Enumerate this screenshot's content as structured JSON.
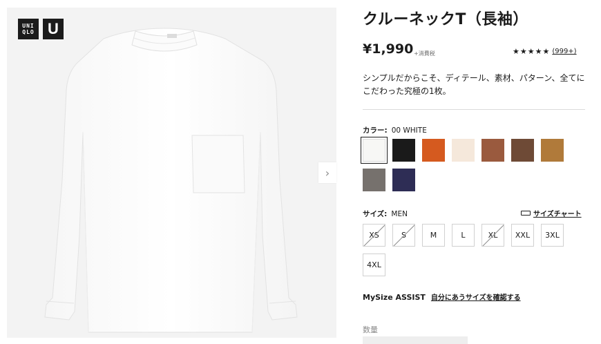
{
  "brand": {
    "logo_text_top": "UNI",
    "logo_text_bottom": "QLO",
    "logo_u": "U"
  },
  "product": {
    "title": "クルーネックT（長袖）",
    "price": "¥1,990",
    "tax_note": "+消費税",
    "rating_stars": "★★★★★",
    "review_count": "(999+)",
    "description": "シンプルだからこそ、ディテール、素材、パターン、全てにこだわった究極の1枚。"
  },
  "color": {
    "label": "カラー:",
    "selected": "00 WHITE",
    "swatches": [
      {
        "name": "WHITE",
        "hex": "#f7f7f5"
      },
      {
        "name": "BLACK",
        "hex": "#1a1a1a"
      },
      {
        "name": "ORANGE",
        "hex": "#d55a1f"
      },
      {
        "name": "NATURAL",
        "hex": "#f5e8db"
      },
      {
        "name": "BROWN",
        "hex": "#9a5a3e"
      },
      {
        "name": "DARK BROWN",
        "hex": "#6e4a36"
      },
      {
        "name": "MUSTARD",
        "hex": "#b07a3a"
      },
      {
        "name": "GRAY",
        "hex": "#76716d"
      },
      {
        "name": "NAVY",
        "hex": "#2e2d55"
      }
    ]
  },
  "size": {
    "label": "サイズ:",
    "selected": "MEN",
    "chart_link": "サイズチャート",
    "options": [
      {
        "label": "XS",
        "available": false
      },
      {
        "label": "S",
        "available": false
      },
      {
        "label": "M",
        "available": true
      },
      {
        "label": "L",
        "available": true
      },
      {
        "label": "XL",
        "available": false
      },
      {
        "label": "XXL",
        "available": true
      },
      {
        "label": "3XL",
        "available": true
      },
      {
        "label": "4XL",
        "available": true
      }
    ]
  },
  "mysize": {
    "brand": "MySize ASSIST",
    "link": "自分にあうサイズを確認する"
  },
  "quantity": {
    "label": "数量"
  },
  "gallery": {
    "next_icon": "chevron-right-icon",
    "next_glyph": "›"
  }
}
